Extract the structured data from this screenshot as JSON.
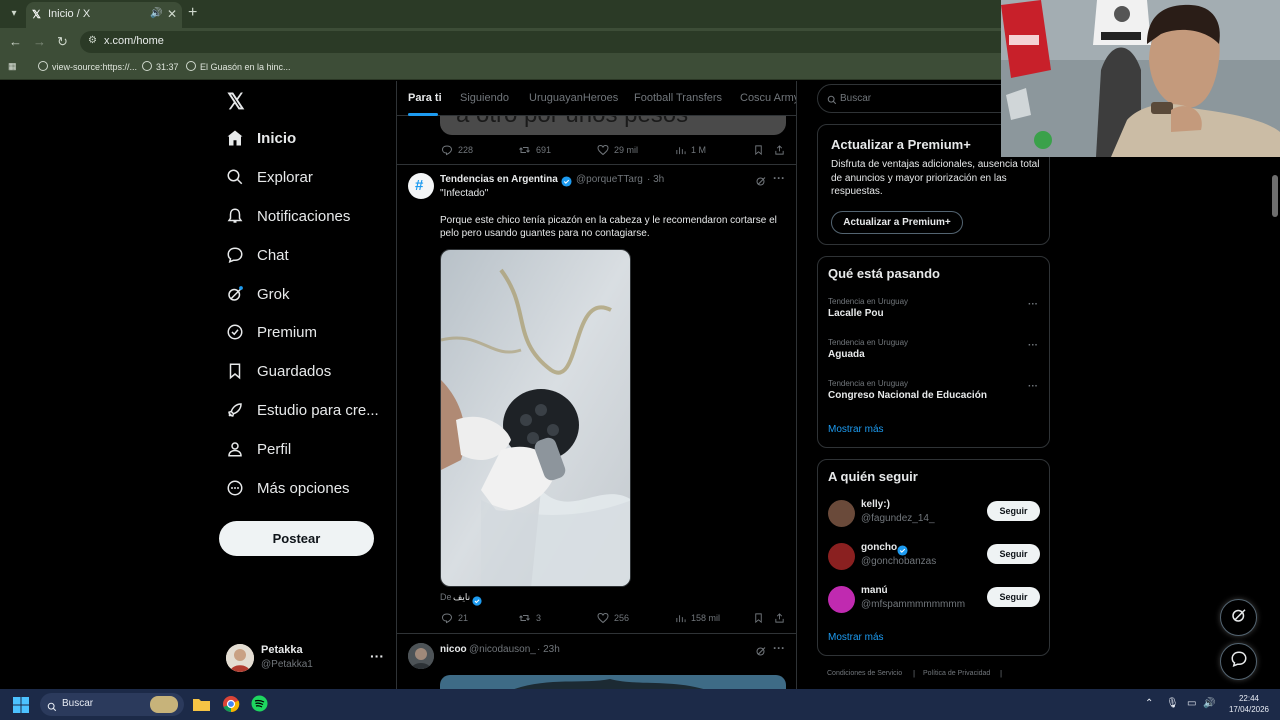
{
  "browser": {
    "tab_title": "Inicio / X",
    "url": "x.com/home",
    "bookmarks": [
      "view-source:https://...",
      "31:37",
      "El Guasón en la hinc..."
    ]
  },
  "sidebar": {
    "items": [
      {
        "label": "Inicio",
        "icon": "home-icon"
      },
      {
        "label": "Explorar",
        "icon": "search-icon"
      },
      {
        "label": "Notificaciones",
        "icon": "bell-icon"
      },
      {
        "label": "Chat",
        "icon": "chat-icon"
      },
      {
        "label": "Grok",
        "icon": "grok-icon"
      },
      {
        "label": "Premium",
        "icon": "verified-icon"
      },
      {
        "label": "Guardados",
        "icon": "bookmark-icon"
      },
      {
        "label": "Estudio para cre...",
        "icon": "rocket-icon"
      },
      {
        "label": "Perfil",
        "icon": "person-icon"
      },
      {
        "label": "Más opciones",
        "icon": "more-circle-icon"
      }
    ],
    "post_label": "Postear",
    "profile": {
      "name": "Petakka",
      "handle": "@Petakka1"
    }
  },
  "feed": {
    "tabs": [
      "Para ti",
      "Siguiendo",
      "UruguayanHeroes",
      "Football Transfers",
      "Coscu Army"
    ],
    "top_post_partial_text": "a otro por unos pesos",
    "top_post_stats": {
      "replies": "228",
      "reposts": "691",
      "likes": "29 mil",
      "views": "1 M"
    },
    "post": {
      "author": "Tendencias en Argentina",
      "handle": "@porqueTTarg",
      "time": "· 3h",
      "line1": "\"Infectado\"",
      "body": "Porque este chico tenía picazón en la cabeza y le recomendaron cortarse el pelo pero usando guantes para no contagiarse.",
      "via_prefix": "De",
      "via_name": "نايف",
      "stats": {
        "replies": "21",
        "reposts": "3",
        "likes": "256",
        "views": "158 mil"
      }
    },
    "next_post": {
      "author": "nicoo",
      "handle": "@nicodauson_",
      "time": "· 23h"
    }
  },
  "right": {
    "search_placeholder": "Buscar",
    "premium": {
      "title": "Actualizar a Premium+",
      "desc": "Disfruta de ventajas adicionales, ausencia total de anuncios y mayor priorización en las respuestas.",
      "button": "Actualizar a Premium+"
    },
    "trends": {
      "title": "Qué está pasando",
      "items": [
        {
          "context": "Tendencia en Uruguay",
          "name": "Lacalle Pou"
        },
        {
          "context": "Tendencia en Uruguay",
          "name": "Aguada"
        },
        {
          "context": "Tendencia en Uruguay",
          "name": "Congreso Nacional de Educación"
        }
      ],
      "more": "Mostrar más"
    },
    "who_to_follow": {
      "title": "A quién seguir",
      "items": [
        {
          "name": "kelly:)",
          "handle": "@fagundez_14_",
          "button": "Seguir",
          "verified": false,
          "avatar_color": "#6a4a3a"
        },
        {
          "name": "goncho",
          "handle": "@gonchobanzas",
          "button": "Seguir",
          "verified": true,
          "avatar_color": "#8a2020"
        },
        {
          "name": "manú",
          "handle": "@mfspammmmmmmm",
          "button": "Seguir",
          "verified": false,
          "avatar_color": "#c02ab0"
        }
      ],
      "more": "Mostrar más"
    },
    "footer": [
      "Condiciones de Servicio",
      "Política de Privacidad"
    ]
  },
  "taskbar": {
    "search": "Buscar",
    "time": "22:44",
    "date": "17/04/2026"
  },
  "colors": {
    "accent": "#1d9bf0",
    "background": "#000000",
    "text": "#e7e9ea",
    "muted": "#71767b"
  }
}
